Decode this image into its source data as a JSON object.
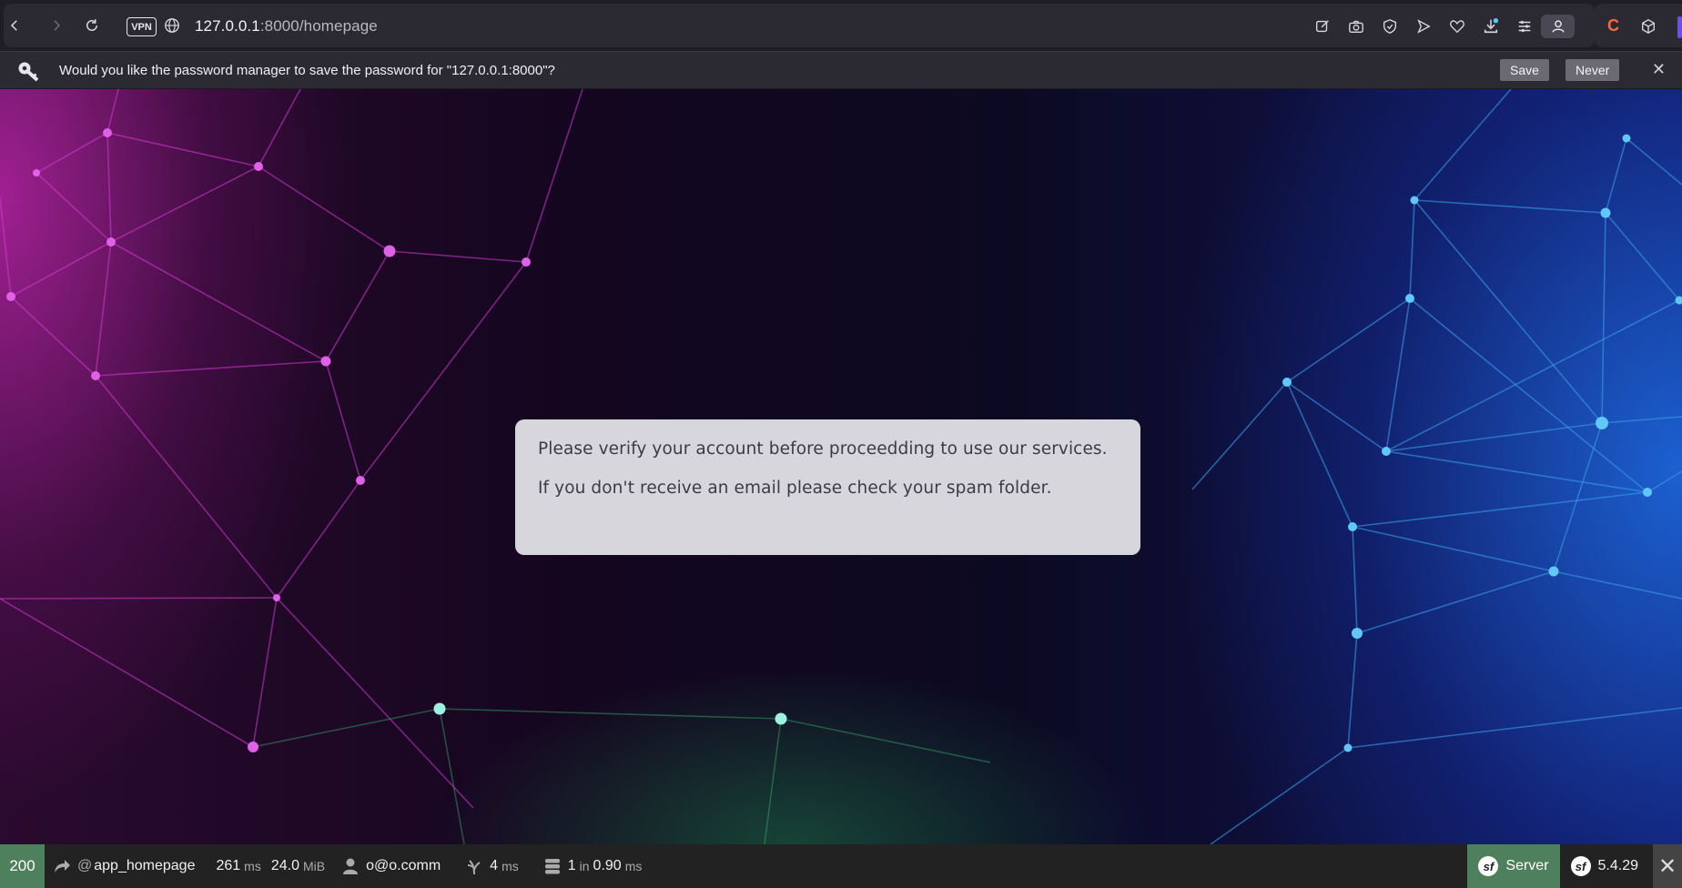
{
  "browser": {
    "url_host": "127.0.0.1",
    "url_path": ":8000/homepage",
    "vpn_label": "VPN",
    "icons": [
      "back-icon",
      "forward-icon",
      "reload-icon",
      "edit-icon",
      "camera-icon",
      "shield-icon",
      "play-icon",
      "heart-icon",
      "download-icon",
      "menu-icon",
      "profile-icon"
    ]
  },
  "password_prompt": {
    "message": "Would you like the password manager to save the password for \"127.0.0.1:8000\"?",
    "save_label": "Save",
    "never_label": "Never"
  },
  "notice": {
    "line1": "Please verify your account before proceedding to use our services.",
    "line2": "If you don't receive an email please check your spam folder."
  },
  "debug_toolbar": {
    "status_code": "200",
    "route_prefix": "@",
    "route": "app_homepage",
    "time_value": "261",
    "time_unit": "ms",
    "memory_value": "24.0",
    "memory_unit": "MiB",
    "user": "o@o.comm",
    "twig_value": "4",
    "twig_unit": "ms",
    "db_count": "1",
    "db_in": "in",
    "db_time": "0.90",
    "db_unit": "ms",
    "server_label": "Server",
    "symfony_version": "5.4.29",
    "status_color": "#4f805d"
  }
}
